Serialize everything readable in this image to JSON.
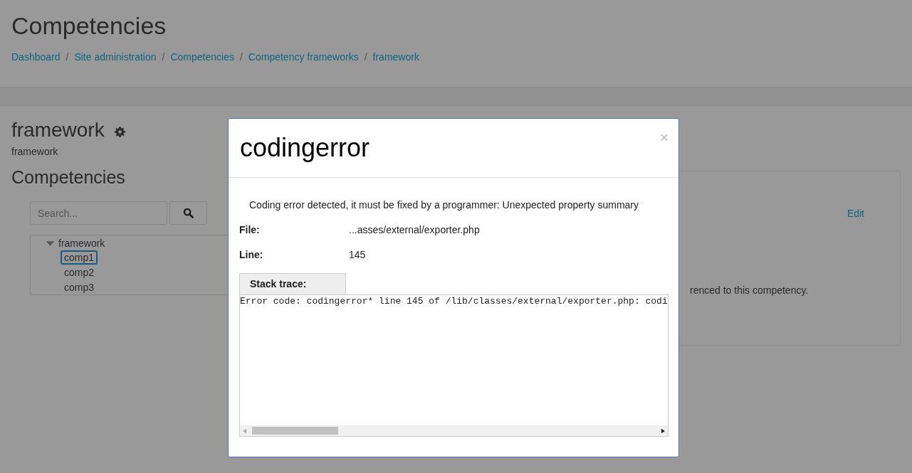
{
  "page": {
    "title": "Competencies",
    "breadcrumb_separator": "/",
    "breadcrumb": [
      "Dashboard",
      "Site administration",
      "Competencies",
      "Competency frameworks",
      "framework"
    ],
    "framework_title": "framework",
    "framework_subtitle": "framework",
    "section_title": "Competencies",
    "search": {
      "placeholder": "Search..."
    },
    "tree": {
      "label": "framework",
      "expanded": true,
      "children": [
        {
          "label": "comp1",
          "selected": true
        },
        {
          "label": "comp2",
          "selected": false
        },
        {
          "label": "comp3",
          "selected": false
        }
      ]
    },
    "detail": {
      "edit_link": "Edit",
      "text": "renced to this competency."
    }
  },
  "modal": {
    "title": "codingerror",
    "close": "×",
    "message": "Coding error detected, it must be fixed by a programmer: Unexpected property summary",
    "fields": [
      {
        "label": "File:",
        "value": "...asses/external/exporter.php"
      },
      {
        "label": "Line:",
        "value": "145"
      }
    ],
    "stack_tab": "Stack trace:",
    "stack_text": "Error code: codingerror* line 145 of /lib/classes/external/exporter.php: codi"
  }
}
